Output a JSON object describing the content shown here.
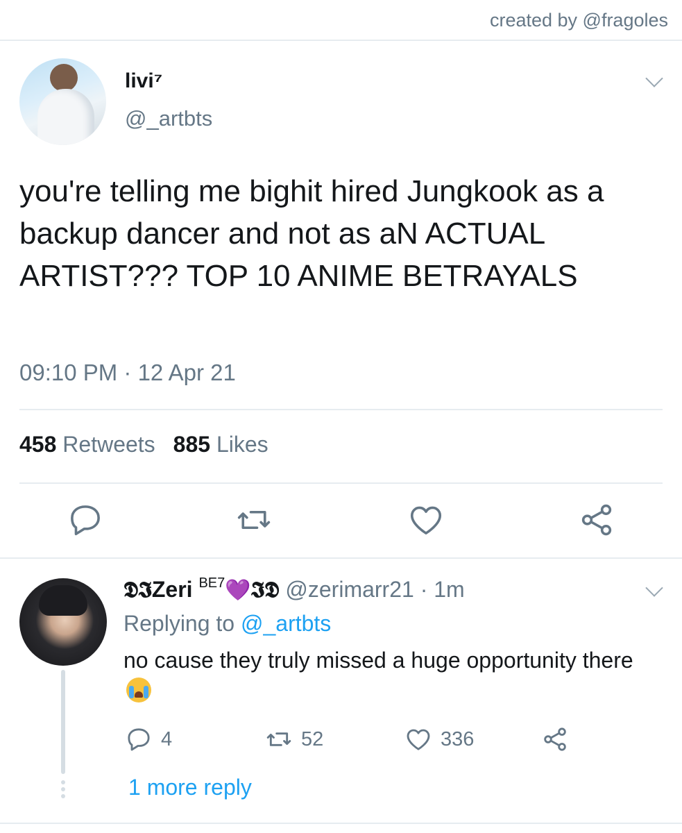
{
  "credit": "created by @fragoles",
  "main_tweet": {
    "display_name": "livi⁷",
    "handle": "@_artbts",
    "text": "you're telling me bighit hired Jungkook as a backup dancer and not as aN ACTUAL ARTIST??? TOP 10 ANIME BETRAYALS",
    "timestamp": "09:10 PM · 12 Apr 21",
    "retweet_count": "458",
    "retweet_label": "Retweets",
    "like_count": "885",
    "like_label": "Likes",
    "icons": [
      "chevron-down-icon",
      "reply-icon",
      "retweet-icon",
      "like-icon",
      "share-icon"
    ]
  },
  "reply": {
    "display_name": "𝕯𝕴Zeri",
    "superscript": "BE7",
    "heart_emoji": "💜",
    "trail": "𝕴𝕯",
    "handle": "@zerimarr21",
    "time": "· 1m",
    "replying_prefix": "Replying to",
    "replying_handle": "@_artbts",
    "text": "no cause they truly missed a huge opportunity there",
    "emoji": "crying-face-emoji",
    "reply_count": "4",
    "retweet_count": "52",
    "like_count": "336",
    "more_replies": "1 more reply"
  },
  "colors": {
    "text": "#14171a",
    "secondary": "#657786",
    "link": "#1da1f2",
    "divider": "#e6ecf0"
  }
}
